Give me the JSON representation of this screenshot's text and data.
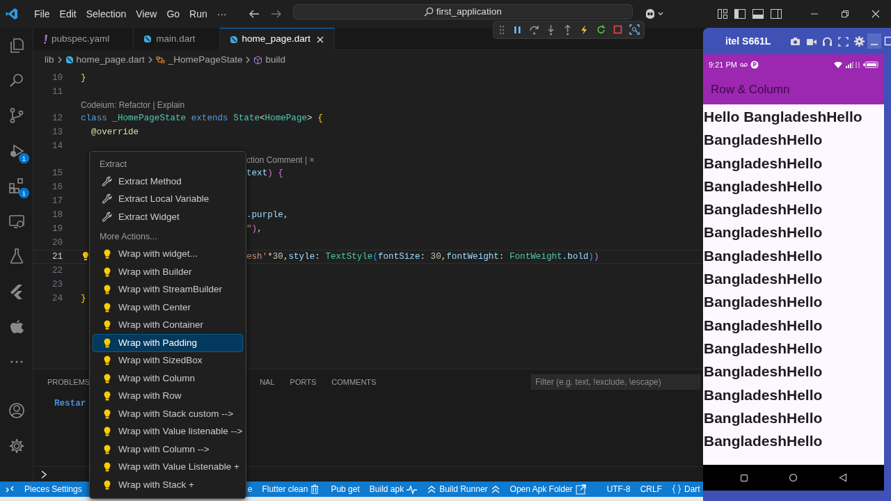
{
  "title_bar": {
    "menus": [
      "File",
      "Edit",
      "Selection",
      "View",
      "Go",
      "Run"
    ],
    "more": "···",
    "search": "first_application"
  },
  "activity_bar": {
    "items": [
      {
        "kind": "explorer"
      },
      {
        "kind": "search"
      },
      {
        "kind": "scm"
      },
      {
        "kind": "debug",
        "badge": "1"
      },
      {
        "kind": "extensions",
        "badge": "1"
      },
      {
        "kind": "remote"
      },
      {
        "kind": "testing"
      },
      {
        "kind": "flutter"
      },
      {
        "kind": "apple"
      },
      {
        "kind": "more"
      }
    ],
    "bottom": [
      {
        "kind": "account"
      },
      {
        "kind": "settings"
      }
    ]
  },
  "tabs": [
    {
      "label": "pubspec.yaml",
      "kind": "yaml",
      "selected": false
    },
    {
      "label": "main.dart",
      "kind": "dart",
      "selected": false
    },
    {
      "label": "home_page.dart",
      "kind": "dart",
      "selected": true
    }
  ],
  "breadcrumb": [
    {
      "label": "lib",
      "kind": "folder"
    },
    {
      "label": "home_page.dart",
      "kind": "dart"
    },
    {
      "label": "_HomePageState",
      "kind": "class"
    },
    {
      "label": "build",
      "kind": "method"
    }
  ],
  "code_lines": [
    {
      "number": "10",
      "current": false,
      "tokens": [
        {
          "text": "}",
          "kind": "brace"
        }
      ]
    },
    {
      "number": "11",
      "current": false
    },
    {
      "kind": "lens",
      "text": "Codeium: Refactor | Explain"
    },
    {
      "number": "12",
      "current": false,
      "tokens": [
        {
          "text": "class ",
          "kind": "keyword"
        },
        {
          "text": "_HomePageState ",
          "kind": "type"
        },
        {
          "text": "extends ",
          "kind": "keyword"
        },
        {
          "text": "State",
          "kind": "type"
        },
        {
          "text": "<",
          "kind": "punct"
        },
        {
          "text": "HomePage",
          "kind": "type"
        },
        {
          "text": "> ",
          "kind": "punct"
        },
        {
          "text": "{",
          "kind": "brace"
        }
      ]
    },
    {
      "number": "13",
      "current": false,
      "tokens": [
        {
          "text": "  @override",
          "kind": "annotation"
        }
      ]
    },
    {
      "number": "14",
      "current": false
    },
    {
      "kind": "lens",
      "covered": true,
      "text": "ction Comment | ×"
    },
    {
      "number": "15",
      "current": false,
      "covered": true,
      "tokens": [
        {
          "text": "text",
          "kind": "variable"
        },
        {
          "text": ") {",
          "kind": "brace2"
        }
      ]
    },
    {
      "number": "16",
      "current": false,
      "covered": true
    },
    {
      "number": "17",
      "current": false,
      "covered": true
    },
    {
      "number": "18",
      "current": false,
      "covered": true,
      "tokens": [
        {
          "text": ".purple",
          "kind": "variable"
        },
        {
          "text": ",",
          "kind": "punct"
        }
      ]
    },
    {
      "number": "19",
      "current": false,
      "covered": true,
      "tokens": [
        {
          "text": "\"",
          "kind": "string"
        },
        {
          "text": ")",
          "kind": "brace2"
        },
        {
          "text": ",",
          "kind": "punct"
        }
      ]
    },
    {
      "number": "20",
      "current": false,
      "covered": true
    },
    {
      "number": "21",
      "current": true,
      "covered": true,
      "tokens": [
        {
          "text": "esh'",
          "kind": "string"
        },
        {
          "text": "*",
          "kind": "punct"
        },
        {
          "text": "30",
          "kind": "number"
        },
        {
          "text": ",",
          "kind": "punct"
        },
        {
          "text": "style",
          "kind": "variable"
        },
        {
          "text": ": ",
          "kind": "punct"
        },
        {
          "text": "TextStyle",
          "kind": "type"
        },
        {
          "text": "(",
          "kind": "brace3"
        },
        {
          "text": "fontSize",
          "kind": "variable"
        },
        {
          "text": ": ",
          "kind": "punct"
        },
        {
          "text": "30",
          "kind": "number"
        },
        {
          "text": ",",
          "kind": "punct"
        },
        {
          "text": "fontWeight",
          "kind": "variable"
        },
        {
          "text": ": ",
          "kind": "punct"
        },
        {
          "text": "FontWeight",
          "kind": "type"
        },
        {
          "text": ".bold",
          "kind": "variable"
        },
        {
          "text": ")",
          "kind": "brace3"
        },
        {
          "text": ")",
          "kind": "brace2"
        }
      ]
    },
    {
      "number": "22",
      "current": false,
      "covered": true
    },
    {
      "number": "23",
      "current": false,
      "covered": true
    },
    {
      "number": "24",
      "current": false,
      "tokens": [
        {
          "text": "}",
          "kind": "brace"
        }
      ]
    }
  ],
  "context_menu": {
    "sections": [
      {
        "header": "Extract",
        "items": [
          {
            "label": "Extract Method",
            "kind": "extract",
            "selected": false
          },
          {
            "label": "Extract Local Variable",
            "kind": "extract",
            "selected": false
          },
          {
            "label": "Extract Widget",
            "kind": "extract",
            "selected": false
          }
        ]
      },
      {
        "header": "More Actions...",
        "items": [
          {
            "label": "Wrap with widget...",
            "kind": "wrap",
            "selected": false
          },
          {
            "label": "Wrap with Builder",
            "kind": "wrap",
            "selected": false
          },
          {
            "label": "Wrap with StreamBuilder",
            "kind": "wrap",
            "selected": false
          },
          {
            "label": "Wrap with Center",
            "kind": "wrap",
            "selected": false
          },
          {
            "label": "Wrap with Container",
            "kind": "wrap",
            "selected": false
          },
          {
            "label": "Wrap with Padding",
            "kind": "wrap",
            "selected": true
          },
          {
            "label": "Wrap with SizedBox",
            "kind": "wrap",
            "selected": false
          },
          {
            "label": "Wrap with Column",
            "kind": "wrap",
            "selected": false
          },
          {
            "label": "Wrap with Row",
            "kind": "wrap",
            "selected": false
          },
          {
            "label": "Wrap with Stack custom -->",
            "kind": "wrap",
            "selected": false
          },
          {
            "label": "Wrap with Value listenable -->",
            "kind": "wrap",
            "selected": false
          },
          {
            "label": "Wrap with Column -->",
            "kind": "wrap",
            "selected": false
          },
          {
            "label": "Wrap with Value Listenable +",
            "kind": "wrap",
            "selected": false
          },
          {
            "label": "Wrap with Stack +",
            "kind": "wrap",
            "selected": false
          }
        ]
      }
    ]
  },
  "panel": {
    "tabs": [
      {
        "label": "PROBLEMS"
      },
      {
        "label": "NAL",
        "covered": true
      },
      {
        "label": "PORTS"
      },
      {
        "label": "COMMENTS"
      }
    ],
    "filter": {
      "placeholder": "Filter (e.g. text, !exclude, \\escape)"
    },
    "output": "Restar"
  },
  "status_bar": [
    {
      "kind": "remote"
    },
    {
      "kind": "plain",
      "text": "Pieces Settings"
    },
    {
      "kind": "plain",
      "text": "e",
      "covered": true
    },
    {
      "kind": "clean",
      "text": "Flutter clean"
    },
    {
      "kind": "plain",
      "text": "Pub get"
    },
    {
      "kind": "build",
      "text": "Build apk"
    },
    {
      "kind": "runner",
      "text": "Build Runner"
    },
    {
      "kind": "folder",
      "text": "Open Apk Folder"
    },
    {
      "kind": "plain",
      "text": "UTF-8",
      "gap": true
    },
    {
      "kind": "plain",
      "text": "CRLF"
    },
    {
      "kind": "language",
      "text": "Dart"
    }
  ],
  "emulator": {
    "title": "itel S661L",
    "time": "9:21 PM",
    "app_title": "Row & Column",
    "lines": [
      "Hello BangladeshHello",
      "BangladeshHello",
      "BangladeshHello",
      "BangladeshHello",
      "BangladeshHello",
      "BangladeshHello",
      "BangladeshHello",
      "BangladeshHello",
      "BangladeshHello",
      "BangladeshHello",
      "BangladeshHello",
      "BangladeshHello",
      "BangladeshHello",
      "BangladeshHello",
      "BangladeshHello"
    ]
  }
}
